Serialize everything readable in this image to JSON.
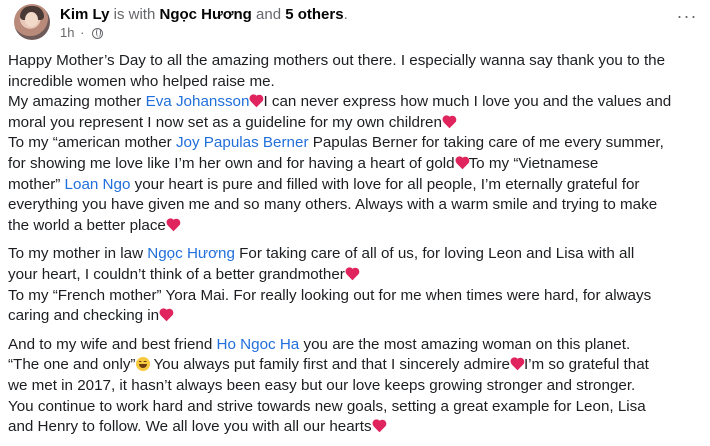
{
  "post": {
    "author": "Kim Ly",
    "with_text": "is with",
    "tagged_person": "Ngọc Hương",
    "and_text": "and",
    "others": "5 others",
    "period": ".",
    "time": "1h",
    "meta_separator": "·",
    "privacy_icon": "globe-icon",
    "more_icon": "more-options-icon",
    "more_label": "···"
  },
  "colors": {
    "tag_link": "#216fdb",
    "heart": "#e0245e",
    "muted": "#65676b"
  },
  "body": {
    "p1": {
      "l1": "Happy Mother’s Day to all the amazing mothers out there. I especially wanna say thank you to the",
      "l2": "incredible women who helped raise me.",
      "l3a": "My amazing mother ",
      "l3_tag": "Eva Johansson",
      "l3b": "I can never express how much I love you and the values and",
      "l4": "moral you represent I now set as a guideline for my own children",
      "l5a": "To my “american mother ",
      "l5_tag": "Joy Papulas Berner",
      "l5b": " Papulas Berner for taking care of me every summer,",
      "l6": "for showing me love like I’m her own and for having a heart of gold",
      "l6b": "To my “Vietnamese",
      "l7a": "mother” ",
      "l7_tag": "Loan Ngo",
      "l7b": " your heart is pure and filled with love for all people, I’m eternally grateful for",
      "l8": "everything you have given me and so many others. Always with a warm smile and trying to make",
      "l9": "the world a better place"
    },
    "p2": {
      "l1a": "To my mother in law ",
      "l1_tag": "Ngọc Hương",
      "l1b": " For taking care of all of us, for loving Leon and Lisa with all",
      "l2": "your heart, I couldn’t think of a better grandmother",
      "l3": "To my “French mother” Yora Mai. For really looking out for me when times were hard, for always",
      "l4": "caring and checking in"
    },
    "p3": {
      "l1a": "And to my wife and best friend ",
      "l1_tag": "Ho Ngoc Ha",
      "l1b": " you are the most amazing woman on this planet.",
      "l2a": "“The one and only”",
      "l2b": " You always put family first and that I sincerely admire",
      "l2c": "I’m so grateful that",
      "l3": "we met in 2017, it hasn’t always been easy but our love keeps growing stronger and stronger.",
      "l4": "You continue to work hard and strive towards new goals, setting a great example for Leon, Lisa",
      "l5": "and Henry to follow. We all love you with all our hearts"
    }
  }
}
